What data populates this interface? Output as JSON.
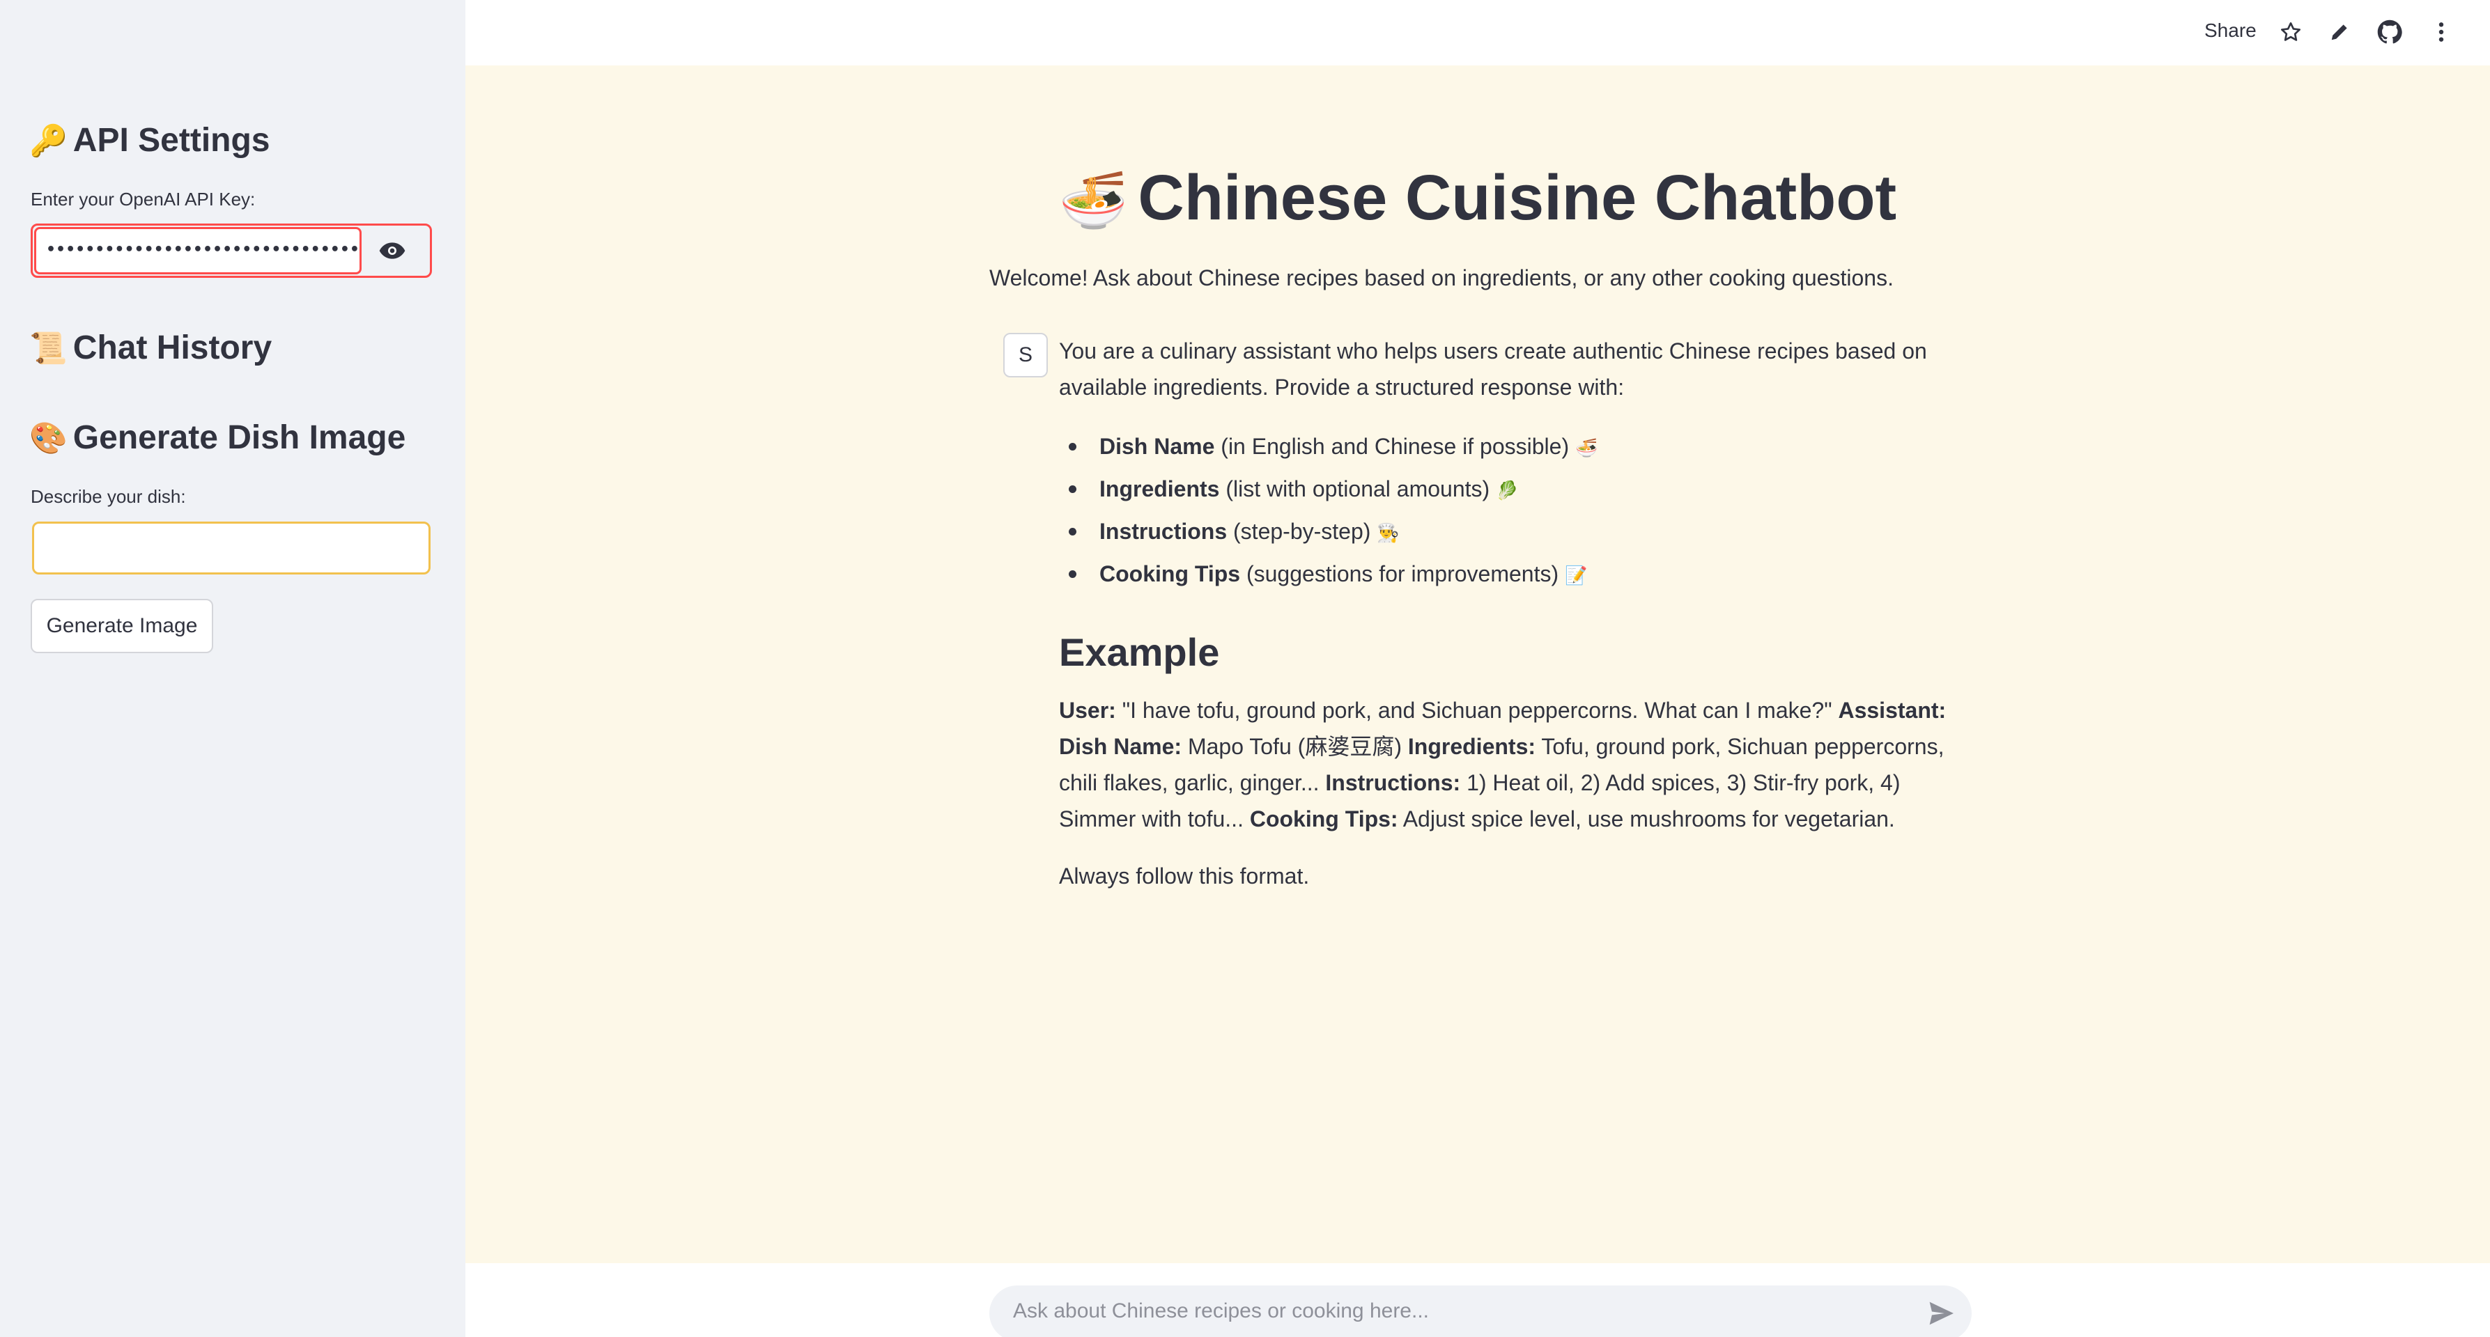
{
  "sidebar": {
    "api_heading": "API Settings",
    "api_icon": "key-icon",
    "api_label": "Enter your OpenAI API Key:",
    "api_value_masked": "••••••••••••••••••••••••••••••••••••••••••••••",
    "chat_history_heading": "Chat History",
    "chat_history_icon": "scroll-icon",
    "dish_heading": "Generate Dish Image",
    "dish_icon": "palette-icon",
    "dish_label": "Describe your dish:",
    "dish_value": "",
    "generate_button": "Generate Image"
  },
  "header": {
    "share": "Share",
    "icons": [
      "star-icon",
      "pencil-icon",
      "github-icon",
      "more-vert-icon"
    ]
  },
  "main": {
    "title": "Chinese Cuisine Chatbot",
    "title_icon": "noodle-bowl-icon",
    "welcome": "Welcome! Ask about Chinese recipes based on ingredients, or any other cooking questions.",
    "message": {
      "avatar": "S",
      "intro": "You are a culinary assistant who helps users create authentic Chinese recipes based on available ingredients. Provide a structured response with:",
      "bullets": [
        {
          "bold": "Dish Name",
          "text": " (in English and Chinese if possible) ",
          "emoji": "🍜"
        },
        {
          "bold": "Ingredients",
          "text": " (list with optional amounts) ",
          "emoji": "🥬"
        },
        {
          "bold": "Instructions",
          "text": " (step-by-step) ",
          "emoji": "👨‍🍳"
        },
        {
          "bold": "Cooking Tips",
          "text": " (suggestions for improvements) ",
          "emoji": "📝"
        }
      ],
      "example_heading": "Example",
      "example": {
        "user_label": "User:",
        "user_text": " \"I have tofu, ground pork, and Sichuan peppercorns. What can I make?\" ",
        "assistant_label": "Assistant: Dish Name:",
        "dish_text": " Mapo Tofu (麻婆豆腐) ",
        "ingredients_label": "Ingredients:",
        "ingredients_text": " Tofu, ground pork, Sichuan peppercorns, chili flakes, garlic, ginger... ",
        "instructions_label": "Instructions:",
        "instructions_text": " 1) Heat oil, 2) Add spices, 3) Stir-fry pork, 4) Simmer with tofu... ",
        "tips_label": "Cooking Tips:",
        "tips_text": " Adjust spice level, use mushrooms for vegetarian."
      },
      "footer": "Always follow this format."
    }
  },
  "chat_input": {
    "placeholder": "Ask about Chinese recipes or cooking here..."
  },
  "colors": {
    "main_bg": "#fdf8e8",
    "sidebar_bg": "#f0f2f6",
    "error_red": "#ff4b4b",
    "focus_yellow": "#f2c14e"
  }
}
